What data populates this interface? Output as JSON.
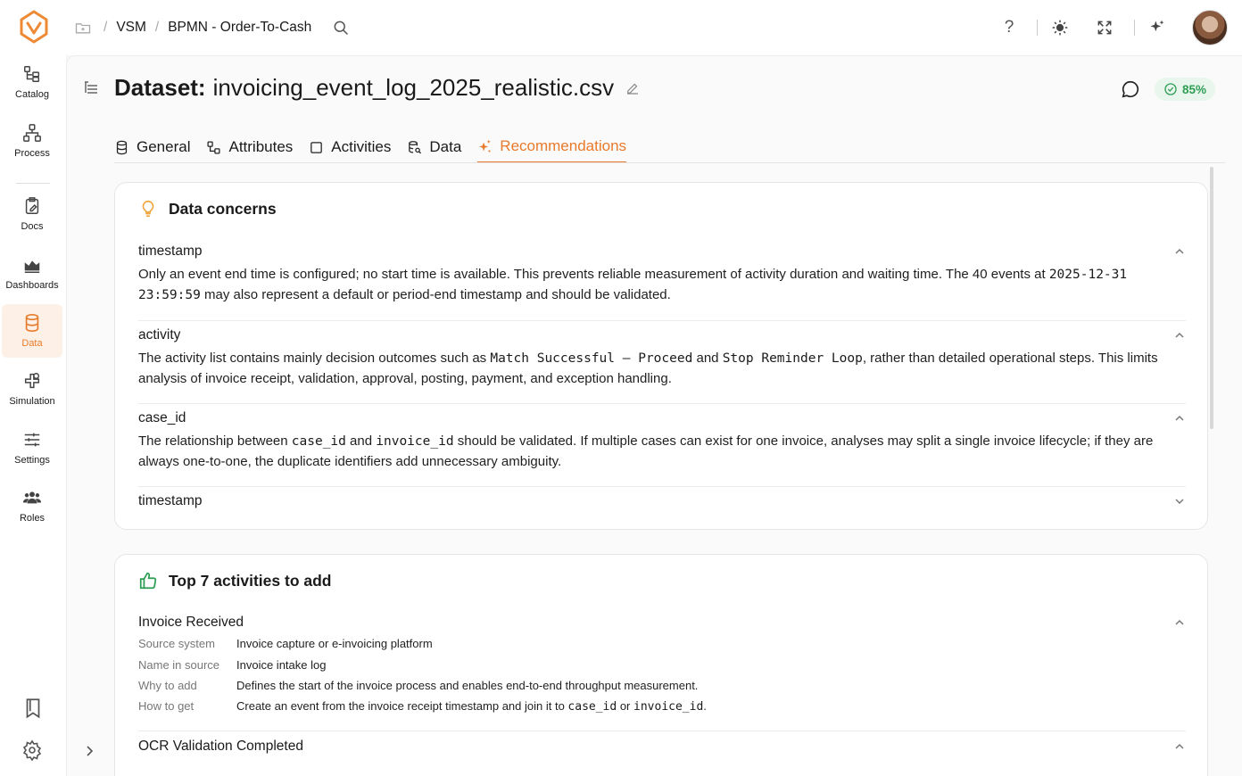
{
  "breadcrumbs": [
    "VSM",
    "BPMN - Order-To-Cash"
  ],
  "sidebar": {
    "items": [
      {
        "label": "Catalog",
        "icon": "catalog-icon"
      },
      {
        "label": "Process",
        "icon": "process-icon"
      },
      {
        "label": "Docs",
        "icon": "docs-icon"
      },
      {
        "label": "Dashboards",
        "icon": "dashboards-icon"
      },
      {
        "label": "Data",
        "icon": "database-icon",
        "active": true
      },
      {
        "label": "Simulation",
        "icon": "simulation-icon"
      },
      {
        "label": "Settings",
        "icon": "sliders-icon"
      },
      {
        "label": "Roles",
        "icon": "users-icon"
      }
    ]
  },
  "page": {
    "title_prefix": "Dataset:",
    "title_name": "invoicing_event_log_2025_realistic.csv",
    "score": "85%"
  },
  "tabs": [
    "General",
    "Attributes",
    "Activities",
    "Data",
    "Recommendations"
  ],
  "active_tab": "Recommendations",
  "concerns": {
    "title": "Data concerns",
    "items": [
      {
        "field": "timestamp",
        "body_a": "Only an event end time is configured; no start time is available. This prevents reliable measurement of activity duration and waiting time. The 40 events at ",
        "code_a": "2025-12-31 23:59:59",
        "body_b": " may also represent a default or period-end timestamp and should be validated."
      },
      {
        "field": "activity",
        "body_a": "The activity list contains mainly decision outcomes such as ",
        "code_a": "Match Successful – Proceed",
        "body_b": " and ",
        "code_b": "Stop Reminder Loop",
        "body_c": ", rather than detailed operational steps. This limits analysis of invoice receipt, validation, approval, posting, payment, and exception handling."
      },
      {
        "field": "case_id",
        "body_a": "The relationship between ",
        "code_a": "case_id",
        "body_b": " and ",
        "code_b": "invoice_id",
        "body_c": " should be validated. If multiple cases can exist for one invoice, analyses may split a single invoice lifecycle; if they are always one-to-one, the duplicate identifiers add unnecessary ambiguity."
      },
      {
        "field": "timestamp"
      }
    ]
  },
  "activities": {
    "title": "Top 7 activities to add",
    "labels": {
      "source": "Source system",
      "name": "Name in source",
      "why": "Why to add",
      "how": "How to get"
    },
    "items": [
      {
        "name": "Invoice Received",
        "source": "Invoice capture or e-invoicing platform",
        "name_in_source": "Invoice intake log",
        "why": "Defines the start of the invoice process and enables end-to-end throughput measurement.",
        "how_a": "Create an event from the invoice receipt timestamp and join it to ",
        "how_code_a": "case_id",
        "how_b": " or ",
        "how_code_b": "invoice_id",
        "how_c": "."
      },
      {
        "name": "OCR Validation Completed"
      }
    ]
  },
  "colors": {
    "accent": "#e87a2b",
    "success": "#2e9e54",
    "concern_icon": "#f0a43a"
  }
}
